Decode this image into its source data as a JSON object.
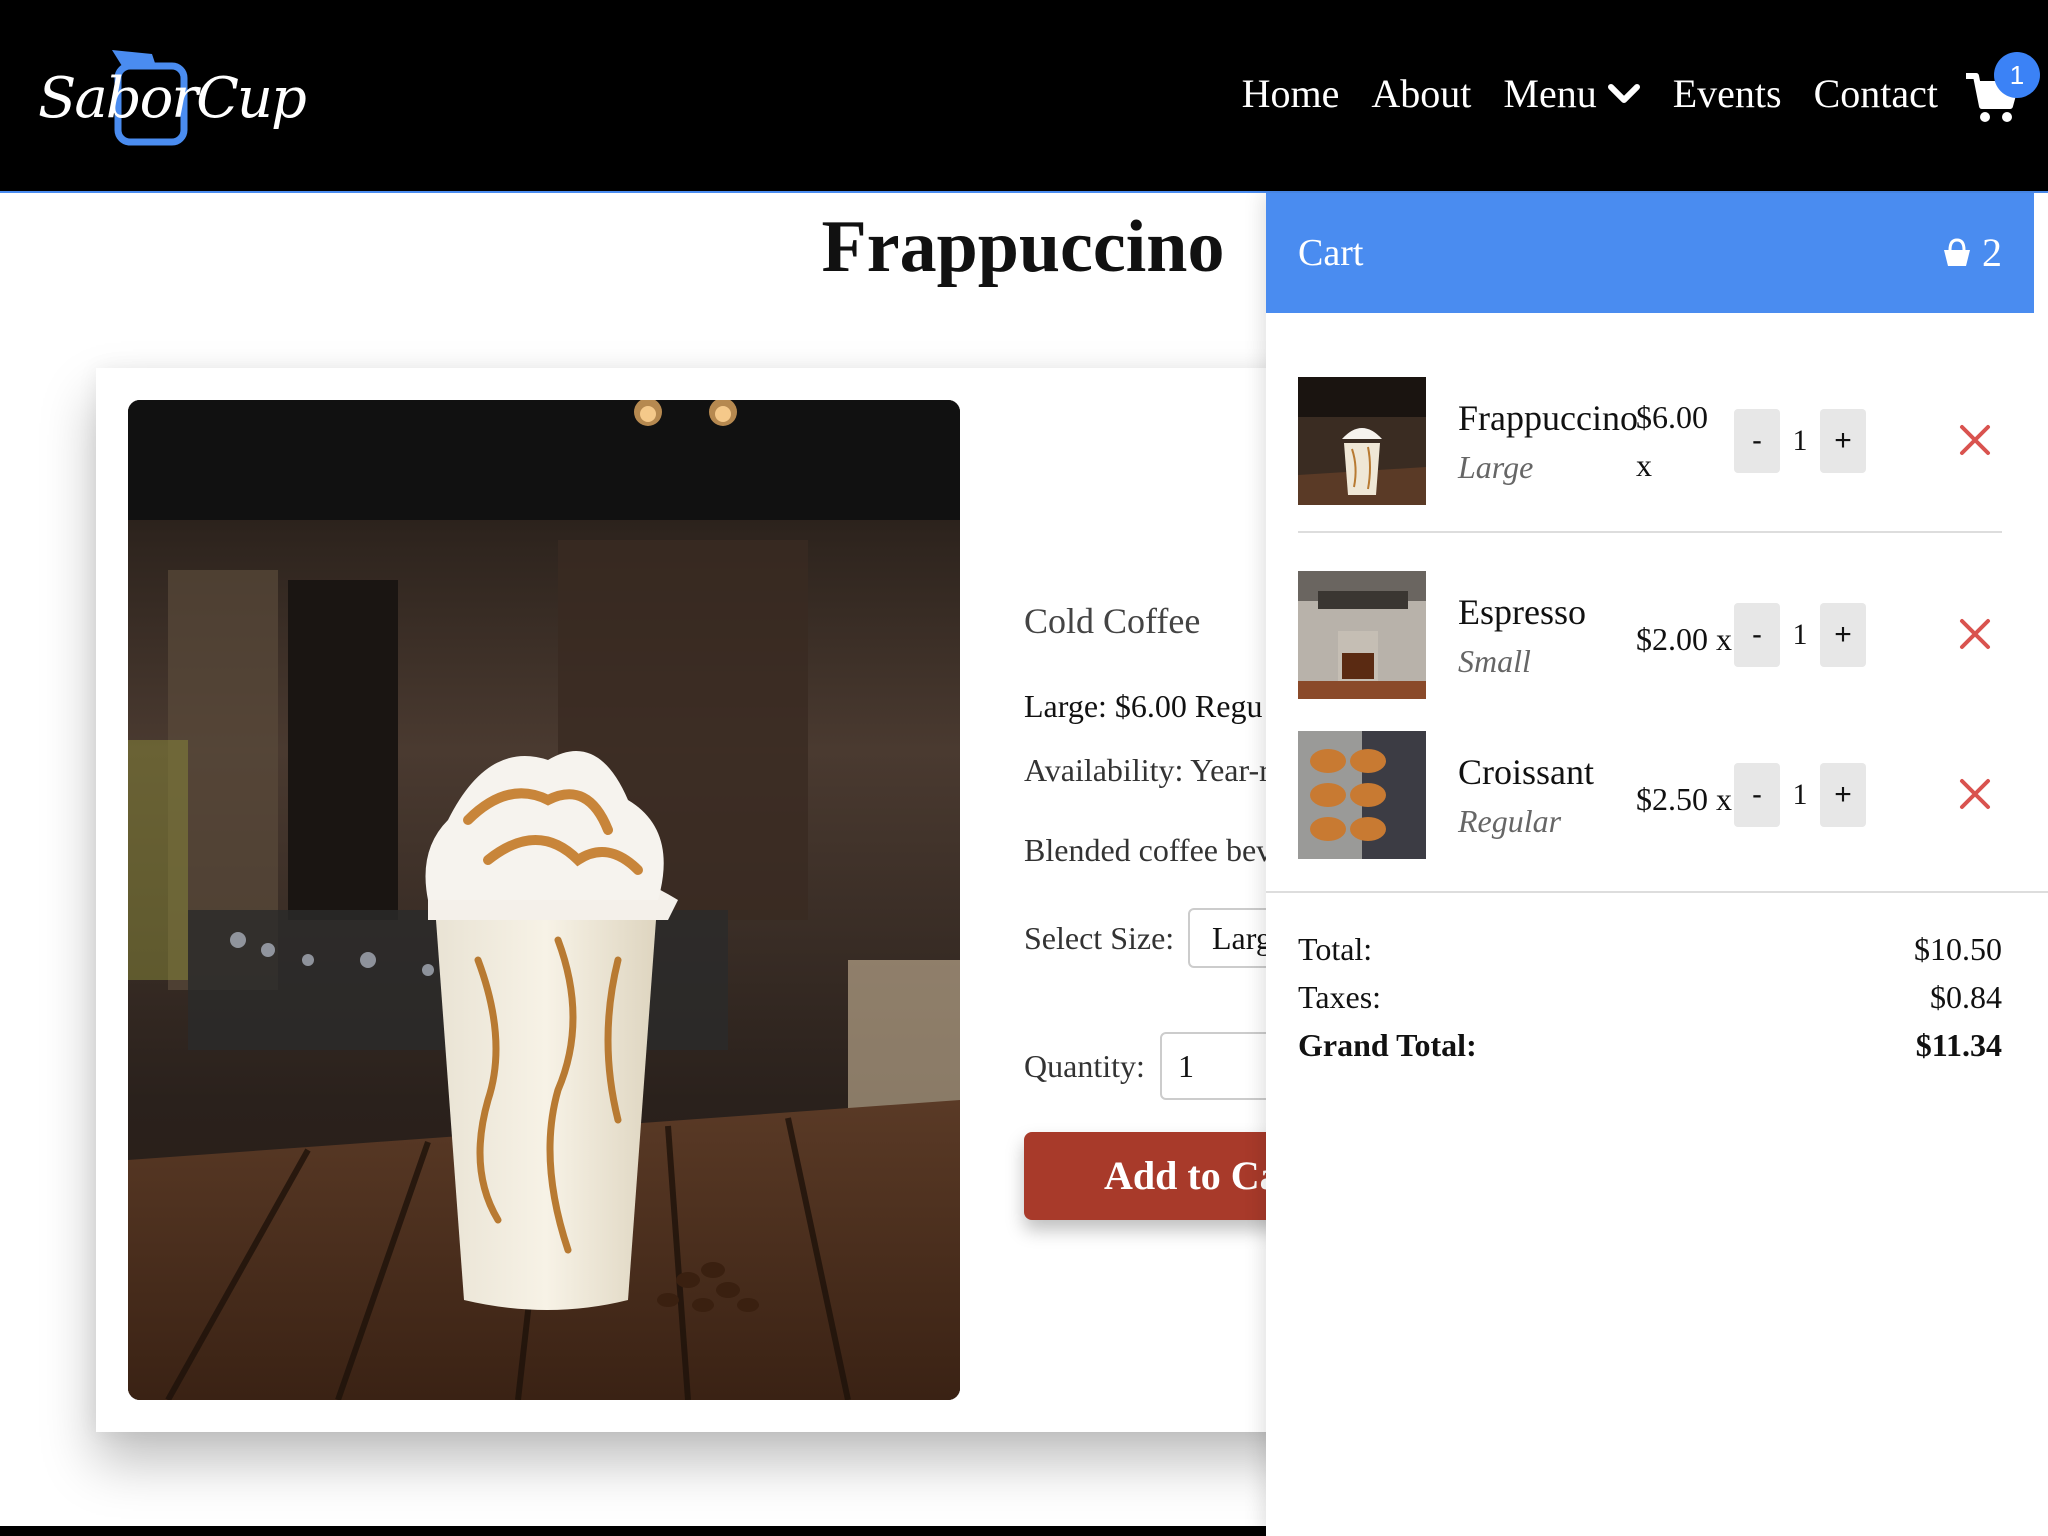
{
  "header": {
    "logo_text": "SaborCup",
    "nav": [
      "Home",
      "About",
      "Menu",
      "Events",
      "Contact"
    ],
    "cart_badge": "1"
  },
  "product": {
    "title": "Frappuccino",
    "category": "Cold Coffee",
    "prices": "Large: $6.00  Regu",
    "availability": "Availability: Year-r",
    "description": "Blended coffee bev",
    "size_label": "Select Size:",
    "size_value": "Larg",
    "quantity_label": "Quantity:",
    "quantity_value": "1",
    "add_button": "Add to Ca"
  },
  "cart": {
    "title": "Cart",
    "count": "2",
    "items": [
      {
        "name": "Frappuccino",
        "size": "Large",
        "price": "$6.00",
        "times": "x",
        "qty": "1",
        "minus": "-",
        "plus": "+"
      },
      {
        "name": "Espresso",
        "size": "Small",
        "price": "$2.00 x",
        "qty": "1",
        "minus": "-",
        "plus": "+"
      },
      {
        "name": "Croissant",
        "size": "Regular",
        "price": "$2.50 x",
        "qty": "1",
        "minus": "-",
        "plus": "+"
      }
    ],
    "totals": {
      "total_label": "Total:",
      "total_value": "$10.50",
      "taxes_label": "Taxes:",
      "taxes_value": "$0.84",
      "grand_label": "Grand Total:",
      "grand_value": "$11.34"
    }
  },
  "colors": {
    "accent_blue": "#4a8cf0",
    "button_red": "#a83a2a",
    "remove_red": "#d9534f"
  }
}
